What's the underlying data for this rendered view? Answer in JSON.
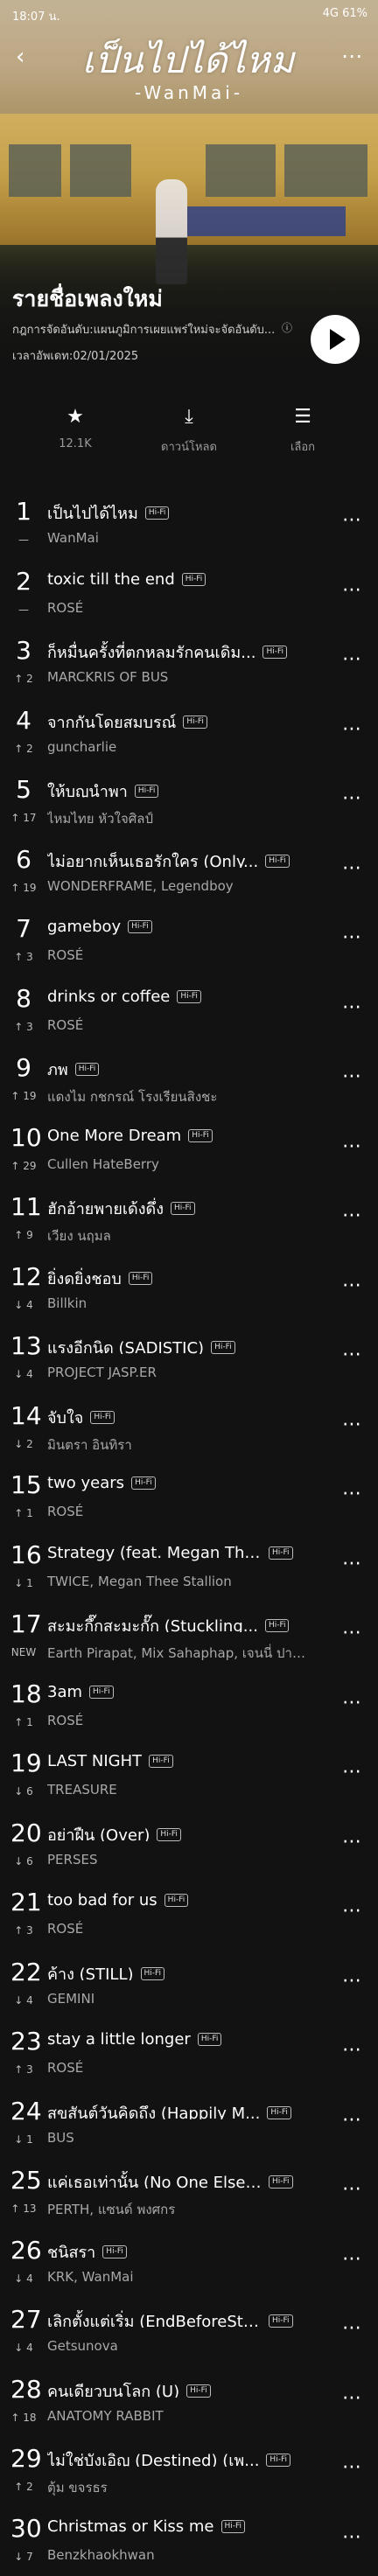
{
  "status_bar": {
    "time": "18:07 น.",
    "right": "4G 61%"
  },
  "header": {
    "logo_text": "เป็นไปได้ไหม",
    "logo_sub": "-WanMai-",
    "playlist_title": "รายชื่อเพลงใหม่",
    "description": "กฎการจัดอันดับ:แผนภูมิการเผยแพร่ใหม่จะจัดอันดับ...",
    "updated": "เวลาอัพเดท:02/01/2025"
  },
  "actions": [
    {
      "icon": "star-icon",
      "label": "12.1K"
    },
    {
      "icon": "download-icon",
      "label": "ดาวน์โหลด"
    },
    {
      "icon": "select-icon",
      "label": "เลือก"
    }
  ],
  "hifi_label": "Hi-Fi",
  "tracks": [
    {
      "rank": "1",
      "change": "—",
      "title": "เป็นไปได้ไหม",
      "artist": "WanMai"
    },
    {
      "rank": "2",
      "change": "—",
      "title": "toxic till the end",
      "artist": "ROSÉ"
    },
    {
      "rank": "3",
      "change": "↑ 2",
      "title": "ก็หมื่นครั้งที่ตกหลุมรักคนเดิม...",
      "artist": "MARCKRIS OF BUS"
    },
    {
      "rank": "4",
      "change": "↑ 2",
      "title": "จากกันโดยสมบูรณ์",
      "artist": "guncharlie"
    },
    {
      "rank": "5",
      "change": "↑ 17",
      "title": "ให้บุญนำพา",
      "artist": "ไหมไทย หัวใจศิลป์"
    },
    {
      "rank": "6",
      "change": "↑ 19",
      "title": "ไม่อยากเห็นเธอรักใคร (Only...",
      "artist": "WONDERFRAME, Legendboy"
    },
    {
      "rank": "7",
      "change": "↑ 3",
      "title": "gameboy",
      "artist": "ROSÉ"
    },
    {
      "rank": "8",
      "change": "↑ 3",
      "title": "drinks or coffee",
      "artist": "ROSÉ"
    },
    {
      "rank": "9",
      "change": "↑ 19",
      "title": "ภพ",
      "artist": "แดงไม กชกรณ์ โรงเรียนสิงชะ"
    },
    {
      "rank": "10",
      "change": "↑ 29",
      "title": "One More Dream",
      "artist": "Cullen HateBerry"
    },
    {
      "rank": "11",
      "change": "↑ 9",
      "title": "ฮักอ้ายพายเด้งดึ่ง",
      "artist": "เวียง นฤมล"
    },
    {
      "rank": "12",
      "change": "↓ 4",
      "title": "ยิ่งดูยิ่งชอบ",
      "artist": "Billkin"
    },
    {
      "rank": "13",
      "change": "↓ 4",
      "title": "แรงอีกนิด (SADISTIC)",
      "artist": "PROJECT JASP.ER"
    },
    {
      "rank": "14",
      "change": "↓ 2",
      "title": "จับใจ",
      "artist": "มินตรา อินทิรา"
    },
    {
      "rank": "15",
      "change": "↑ 1",
      "title": "two years",
      "artist": "ROSÉ"
    },
    {
      "rank": "16",
      "change": "↓ 1",
      "title": "Strategy (feat. Megan Thee...",
      "artist": "TWICE, Megan Thee Stallion"
    },
    {
      "rank": "17",
      "change": "NEW",
      "title": "สะมะกึ๊กสะมะกั๊ก (Stuckling...",
      "artist": "Earth Pirapat, Mix Sahaphap, เจนนี่ ปาหน..."
    },
    {
      "rank": "18",
      "change": "↑ 1",
      "title": "3am",
      "artist": "ROSÉ"
    },
    {
      "rank": "19",
      "change": "↓ 6",
      "title": "LAST NIGHT",
      "artist": "TREASURE"
    },
    {
      "rank": "20",
      "change": "↓ 6",
      "title": "อย่าฝืน (Over)",
      "artist": "PERSES"
    },
    {
      "rank": "21",
      "change": "↑ 3",
      "title": "too bad for us",
      "artist": "ROSÉ"
    },
    {
      "rank": "22",
      "change": "↓ 4",
      "title": "ค้าง (STILL)",
      "artist": "GEMINI"
    },
    {
      "rank": "23",
      "change": "↑ 3",
      "title": "stay a little longer",
      "artist": "ROSÉ"
    },
    {
      "rank": "24",
      "change": "↓ 1",
      "title": "สุขสันต์วันคิดถึง (Happily M...",
      "artist": "BUS"
    },
    {
      "rank": "25",
      "change": "↑ 13",
      "title": "แค่เธอเท่านั้น (No One Else)...",
      "artist": "PERTH, แซนด์ พงศกร"
    },
    {
      "rank": "26",
      "change": "↓ 4",
      "title": "ชนิสรา",
      "artist": "KRK, WanMai"
    },
    {
      "rank": "27",
      "change": "↓ 4",
      "title": "เลิกตั้งแต่เริ่ม (EndBeforeSta...",
      "artist": "Getsunova"
    },
    {
      "rank": "28",
      "change": "↑ 18",
      "title": "คนเดียวบนโลก (U)",
      "artist": "ANATOMY RABBIT"
    },
    {
      "rank": "29",
      "change": "↑ 2",
      "title": "ไม่ใช่บังเอิญ (Destined) (เพ...",
      "artist": "ตุ้ม ขจรธร"
    },
    {
      "rank": "30",
      "change": "↓ 7",
      "title": "Christmas or Kiss me",
      "artist": "Benzkhaokhwan"
    }
  ]
}
